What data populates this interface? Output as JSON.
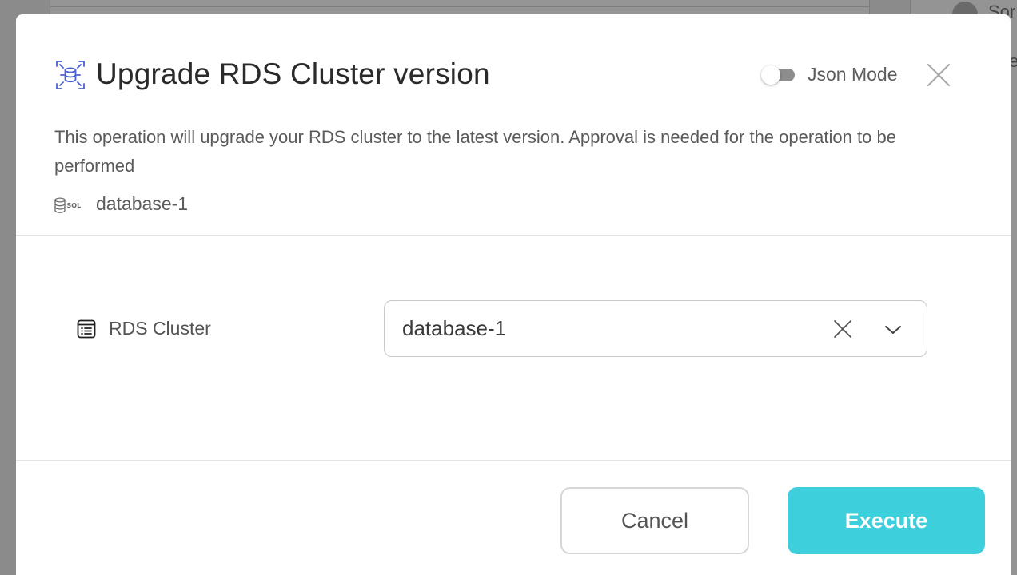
{
  "background": {
    "partial_text_top": "Sor",
    "partial_text_second": "e"
  },
  "dialog": {
    "title": "Upgrade RDS Cluster version",
    "title_icon": "database-scan-icon",
    "json_mode": {
      "label": "Json Mode",
      "enabled": false
    },
    "close_icon": "close-icon",
    "description": "This operation will upgrade your RDS cluster to the latest version. Approval is needed for the operation to be performed",
    "resource": {
      "icon": "sql-database-icon",
      "name": "database-1"
    }
  },
  "form": {
    "field": {
      "icon": "list-icon",
      "label": "RDS Cluster",
      "value": "database-1",
      "clear_icon": "clear-icon",
      "dropdown_icon": "chevron-down-icon"
    }
  },
  "footer": {
    "cancel_label": "Cancel",
    "execute_label": "Execute"
  },
  "colors": {
    "accent": "#3ecfdc",
    "title_icon": "#4a5fd0",
    "backdrop": "#8b8b8b"
  }
}
